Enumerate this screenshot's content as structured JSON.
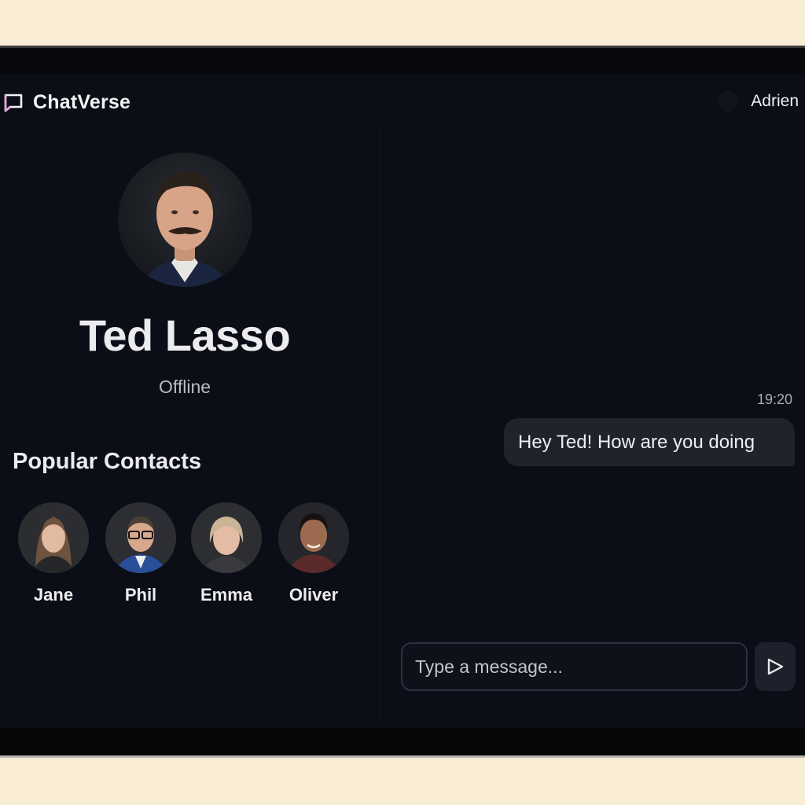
{
  "app": {
    "name": "ChatVerse",
    "logo_color": "#e7a8e0"
  },
  "user": {
    "name": "Adrien"
  },
  "profile": {
    "name": "Ted Lasso",
    "status": "Offline"
  },
  "contacts": {
    "heading": "Popular Contacts",
    "items": [
      {
        "name": "Jane"
      },
      {
        "name": "Phil"
      },
      {
        "name": "Emma"
      },
      {
        "name": "Oliver"
      }
    ]
  },
  "chat": {
    "messages": [
      {
        "time": "19:20",
        "text": "Hey Ted! How are you doing"
      }
    ],
    "composer": {
      "placeholder": "Type a message..."
    },
    "send_icon": "send-icon"
  },
  "colors": {
    "background": "#0b0e16",
    "bubble": "#1f232c",
    "accent": "#e7a8e0"
  }
}
